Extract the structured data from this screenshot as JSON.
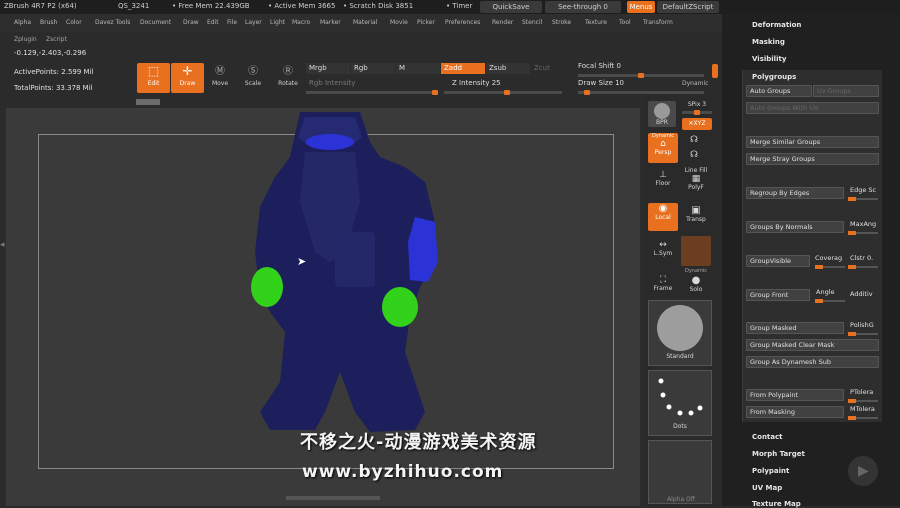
{
  "titlebar": {
    "app": "ZBrush 4R7 P2 (x64)",
    "doc": "QS_3241",
    "free_mem": "• Free Mem 22.439GB",
    "active_mem": "• Active Mem 3665",
    "scratch": "• Scratch Disk 3851",
    "timer": "• Timer",
    "quicksave": "QuickSave",
    "seethrough": "See-through  0",
    "menus": "Menus",
    "defaultzscript": "DefaultZScript"
  },
  "menubar": [
    "Alpha",
    "Brush",
    "Color",
    "Davez Tools",
    "Document",
    "Draw",
    "Edit",
    "File",
    "Layer",
    "Light",
    "Macro",
    "Marker",
    "Material",
    "Movie",
    "Picker",
    "Preferences",
    "Render",
    "Stencil",
    "Stroke",
    "Texture",
    "Tool",
    "Transform"
  ],
  "menubar2": [
    "Zplugin",
    "Zscript"
  ],
  "coords": "-0.129,-2.403,-0.296",
  "stats": {
    "active": "ActivePoints: 2.599 Mil",
    "total": "TotalPoints: 33.378 Mil"
  },
  "toolbar": {
    "edit": "Edit",
    "draw": "Draw",
    "move": "Move",
    "scale": "Scale",
    "rotate": "Rotate",
    "mrgb": "Mrgb",
    "rgb": "Rgb",
    "m": "M",
    "zadd": "Zadd",
    "zsub": "Zsub",
    "zcut": "Zcut",
    "rgb_intensity": "Rgb Intensity",
    "z_intensity": "Z Intensity 25",
    "focal_shift": "Focal Shift 0",
    "draw_size": "Draw Size 10",
    "dynamic": "Dynamic"
  },
  "right_tools": {
    "bpr": "BPR",
    "spix": "SPix 3",
    "xyz": "✕XYZ",
    "dynamic": "Dynamic",
    "persp": "Persp",
    "floor": "Floor",
    "line_fill": "Line Fill",
    "polyf": "PolyF",
    "local": "Local",
    "transp": "Transp",
    "lsym": "L.Sym",
    "dynamic2": "Dynamic",
    "frame": "Frame",
    "solo": "Solo",
    "standard": "Standard",
    "dots": "Dots",
    "alpha_off": "Alpha Off"
  },
  "rpanel": {
    "deformation": "Deformation",
    "masking": "Masking",
    "visibility": "Visibility",
    "polygroups": "Polygroups",
    "contact": "Contact",
    "morph_target": "Morph Target",
    "polypaint": "Polypaint",
    "uv_map": "UV Map",
    "texture_map": "Texture Map"
  },
  "polygroups": {
    "auto_groups": "Auto Groups",
    "uv_groups": "Uv Groups",
    "auto_groups_uv": "Auto Groups With UV",
    "merge_similar": "Merge Similar Groups",
    "merge_stray": "Merge Stray Groups",
    "regroup_edges": "Regroup By Edges",
    "edge_s": "Edge Sc",
    "groups_normals": "Groups By Normals",
    "maxang": "MaxAng",
    "groupvisible": "GroupVisible",
    "coverage": "Coverag",
    "clstr": "Clstr 0.",
    "group_front": "Group Front",
    "angle": "Angle",
    "additive": "Additiv",
    "group_masked": "Group Masked",
    "polishg": "PolishG",
    "group_masked_clear": "Group Masked Clear Mask",
    "group_dynamesh": "Group As Dynamesh Sub",
    "from_polypaint": "From Polypaint",
    "ptolera": "PTolera",
    "from_masking": "From Masking",
    "mtolera": "MTolera"
  },
  "watermark": {
    "line1": "不移之火-动漫游戏美术资源",
    "line2": "www.byzhihuo.com"
  },
  "colors": {
    "accent": "#e8701e",
    "body": "#1c1f5c",
    "highlight": "#2c33d6",
    "green": "#33d21a"
  }
}
